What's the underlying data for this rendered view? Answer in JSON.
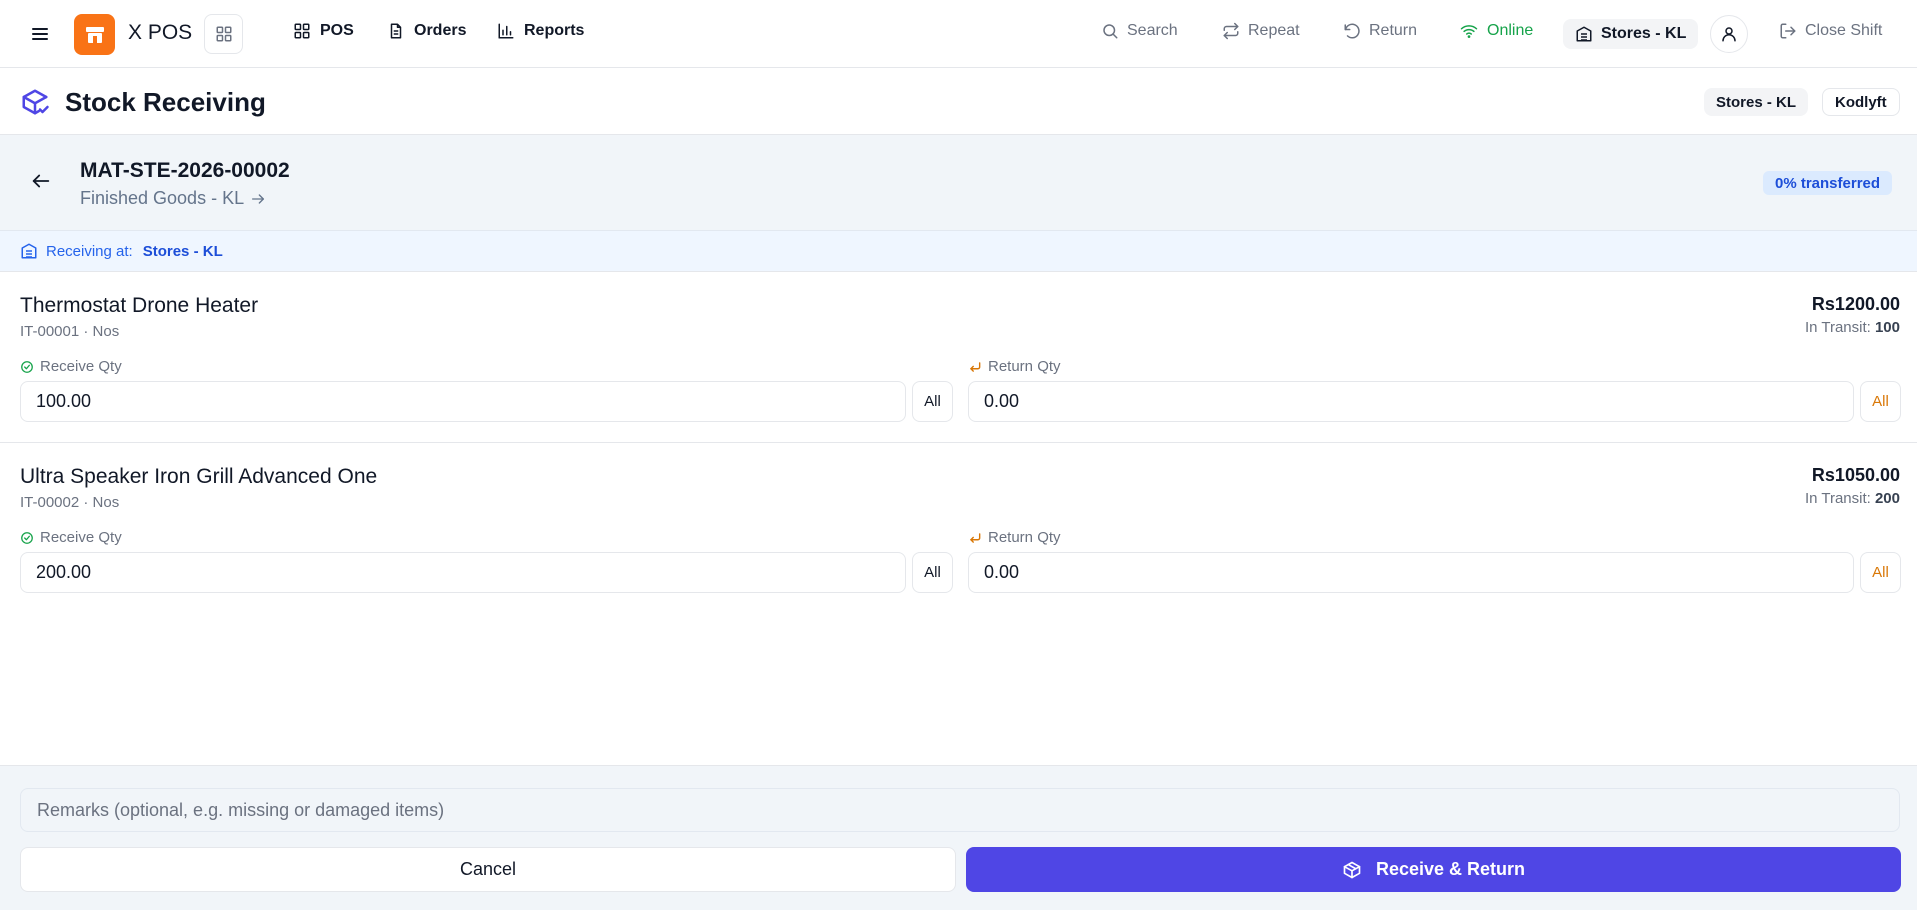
{
  "topbar": {
    "app_name": "X POS",
    "nav": [
      {
        "label": "POS",
        "icon": "grid-icon"
      },
      {
        "label": "Orders",
        "icon": "document-icon"
      },
      {
        "label": "Reports",
        "icon": "bar-chart-icon"
      }
    ],
    "tools": {
      "search": "Search",
      "repeat": "Repeat",
      "return": "Return",
      "online": "Online",
      "store": "Stores - KL",
      "close_shift": "Close Shift"
    }
  },
  "page": {
    "title": "Stock Receiving",
    "store_chip": "Stores - KL",
    "company_chip": "Kodlyft"
  },
  "transfer": {
    "id": "MAT-STE-2026-00002",
    "from": "Finished Goods - KL",
    "progress": "0% transferred"
  },
  "receiving": {
    "label": "Receiving at:",
    "location": "Stores - KL"
  },
  "labels": {
    "receive_qty": "Receive Qty",
    "return_qty": "Return Qty",
    "all": "All",
    "in_transit": "In Transit:"
  },
  "items": [
    {
      "name": "Thermostat Drone Heater",
      "meta": "IT-00001 · Nos",
      "price": "Rs1200.00",
      "in_transit": "100",
      "receive_qty": "100.00",
      "return_qty": "0.00"
    },
    {
      "name": "Ultra Speaker Iron Grill Advanced One",
      "meta": "IT-00002 · Nos",
      "price": "Rs1050.00",
      "in_transit": "200",
      "receive_qty": "200.00",
      "return_qty": "0.00"
    }
  ],
  "footer": {
    "remarks_placeholder": "Remarks (optional, e.g. missing or damaged items)",
    "cancel": "Cancel",
    "submit": "Receive & Return"
  },
  "colors": {
    "accent": "#4f46e5",
    "logo": "#f97316",
    "online": "#16a34a",
    "badge_text": "#1d4ed8",
    "return_orange": "#d97706"
  }
}
